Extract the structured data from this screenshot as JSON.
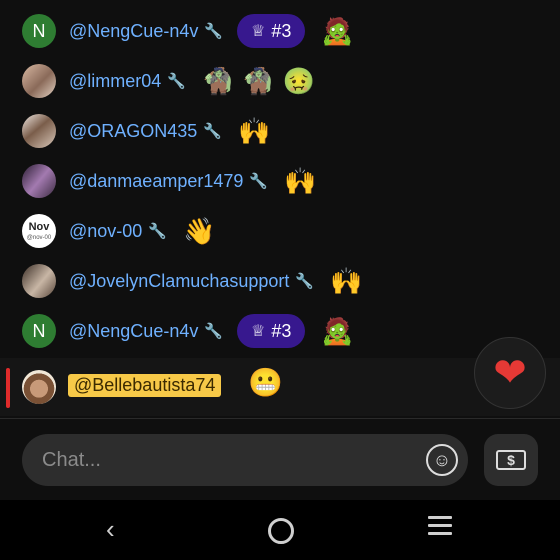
{
  "chat": {
    "messages": [
      {
        "username": "@NengCue-n4v",
        "avatar_letter": "N",
        "rank": "#3",
        "emotes": [
          "🧟"
        ]
      },
      {
        "username": "@limmer04",
        "emotes": [
          "🧌",
          "🧌",
          "🤢"
        ]
      },
      {
        "username": "@ORAGON435",
        "emotes": [
          "🙌"
        ]
      },
      {
        "username": "@danmaeamper1479",
        "emotes": [
          "🙌"
        ]
      },
      {
        "username": "@nov-00",
        "avatar_text": "Nov",
        "avatar_subtext": "@nov-00",
        "emotes": [
          "👋"
        ]
      },
      {
        "username": "@JovelynClamuchasupport",
        "emotes": [
          "🙌"
        ]
      },
      {
        "username": "@NengCue-n4v",
        "avatar_letter": "N",
        "rank": "#3",
        "emotes": [
          "🧟"
        ]
      }
    ],
    "pinned": {
      "username": "@Bellebautista74",
      "emote": "😬"
    }
  },
  "input": {
    "placeholder": "Chat..."
  },
  "icons": {
    "wrench": "wrench-icon",
    "crown": "crown-icon",
    "heart": "heart-icon",
    "emoji": "emoji-icon",
    "money": "money-icon"
  },
  "colors": {
    "username": "#6fb1ff",
    "rank_badge": "#37188e",
    "pinned_highlight": "#f7c948",
    "heart": "#e53935"
  }
}
